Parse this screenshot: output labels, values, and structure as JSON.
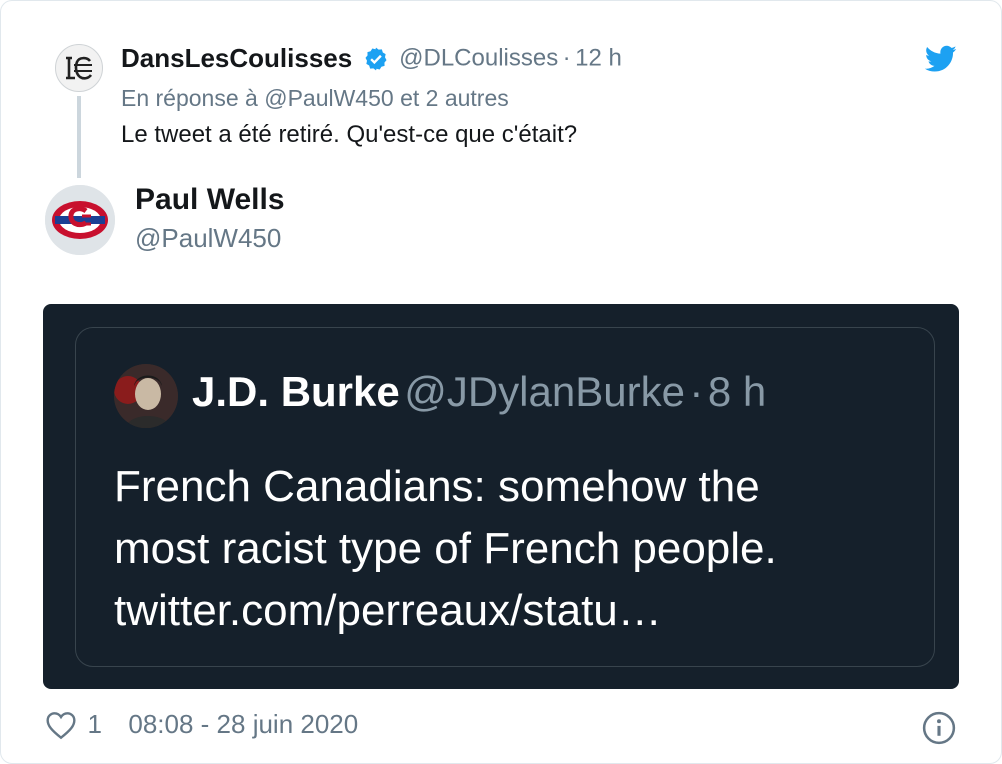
{
  "parent": {
    "name": "DansLesCoulisses",
    "handle": "@DLCoulisses",
    "separator": "·",
    "time": "12 h",
    "reply_prefix": "En réponse à",
    "reply_user": "@PaulW450",
    "reply_suffix": "et 2 autres",
    "text": "Le tweet a été retiré. Qu'est-ce que c'était?"
  },
  "main": {
    "name": "Paul Wells",
    "handle": "@PaulW450"
  },
  "embedded": {
    "name": "J.D. Burke",
    "handle": "@JDylanBurke",
    "separator": "·",
    "time": "8 h",
    "lines": [
      "French Canadians: somehow the",
      "most racist type of French people.",
      "twitter.com/perreaux/statu…"
    ]
  },
  "footer": {
    "like_count": "1",
    "timestamp": "08:08 - 28 juin 2020"
  },
  "icons": {
    "brand": "twitter-bird-icon",
    "verified": "verified-badge-icon",
    "like": "heart-icon",
    "info": "info-icon"
  },
  "colors": {
    "twitter_blue": "#1da1f2",
    "secondary_text": "#657786",
    "dark_bg": "#15202b",
    "habs_red": "#c8102e",
    "habs_blue": "#1c3f94"
  }
}
